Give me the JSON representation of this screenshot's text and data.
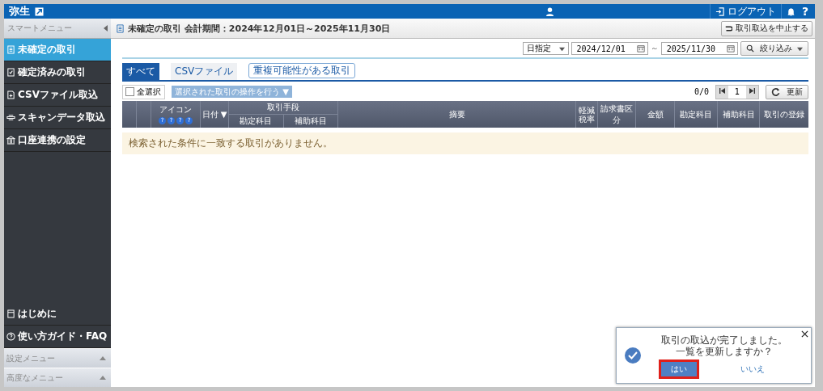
{
  "header": {
    "logo": "弥生",
    "logout": "ログアウト",
    "help": "?"
  },
  "sidebar": {
    "title": "スマートメニュー",
    "items": [
      {
        "label": "未確定の取引",
        "selected": true
      },
      {
        "label": "確定済みの取引",
        "selected": false
      },
      {
        "label": "CSVファイル取込",
        "selected": false
      },
      {
        "label": "スキャンデータ取込",
        "selected": false
      },
      {
        "label": "口座連携の設定",
        "selected": false
      }
    ],
    "bottom_items": [
      {
        "label": "はじめに"
      },
      {
        "label": "使い方ガイド・FAQ"
      }
    ],
    "sections": [
      {
        "label": "設定メニュー",
        "expanded": false
      },
      {
        "label": "高度なメニュー",
        "expanded": false
      }
    ]
  },
  "page": {
    "title": "未確定の取引 会計期間：2024年12月01日～2025年11月30日",
    "cancel_button": "取引取込を中止する"
  },
  "filter": {
    "mode": "日指定",
    "date_from": "2024/12/01",
    "separator": "～",
    "date_to": "2025/11/30",
    "filter_button": "絞り込み"
  },
  "tabs": [
    {
      "label": "すべて",
      "selected": true
    },
    {
      "label": "CSVファイル",
      "selected": false
    },
    {
      "label": "重複可能性がある取引",
      "selected": false
    }
  ],
  "toolbar": {
    "select_all": "全選択",
    "select_all_checked": false,
    "bulk_action": "選択された取引の操作を行う ▼",
    "count": "0/0",
    "page": "1",
    "refresh": "更新"
  },
  "table": {
    "icon_header": "アイコン",
    "icon_marks": [
      "?",
      "?",
      "?",
      "?"
    ],
    "date_header": "日付 ▼",
    "method_header": "取引手段",
    "method_sub": [
      "勘定科目",
      "補助科目"
    ],
    "columns": [
      "摘要",
      "軽減税率",
      "請求書区分",
      "金額",
      "勘定科目",
      "補助科目",
      "取引の登録"
    ],
    "empty_message": "検索された条件に一致する取引がありません。"
  },
  "dialog": {
    "message": [
      "取引の取込が完了しました。",
      "一覧を更新しますか？"
    ],
    "yes": "はい",
    "yes_highlighted": true,
    "no": "いいえ"
  }
}
